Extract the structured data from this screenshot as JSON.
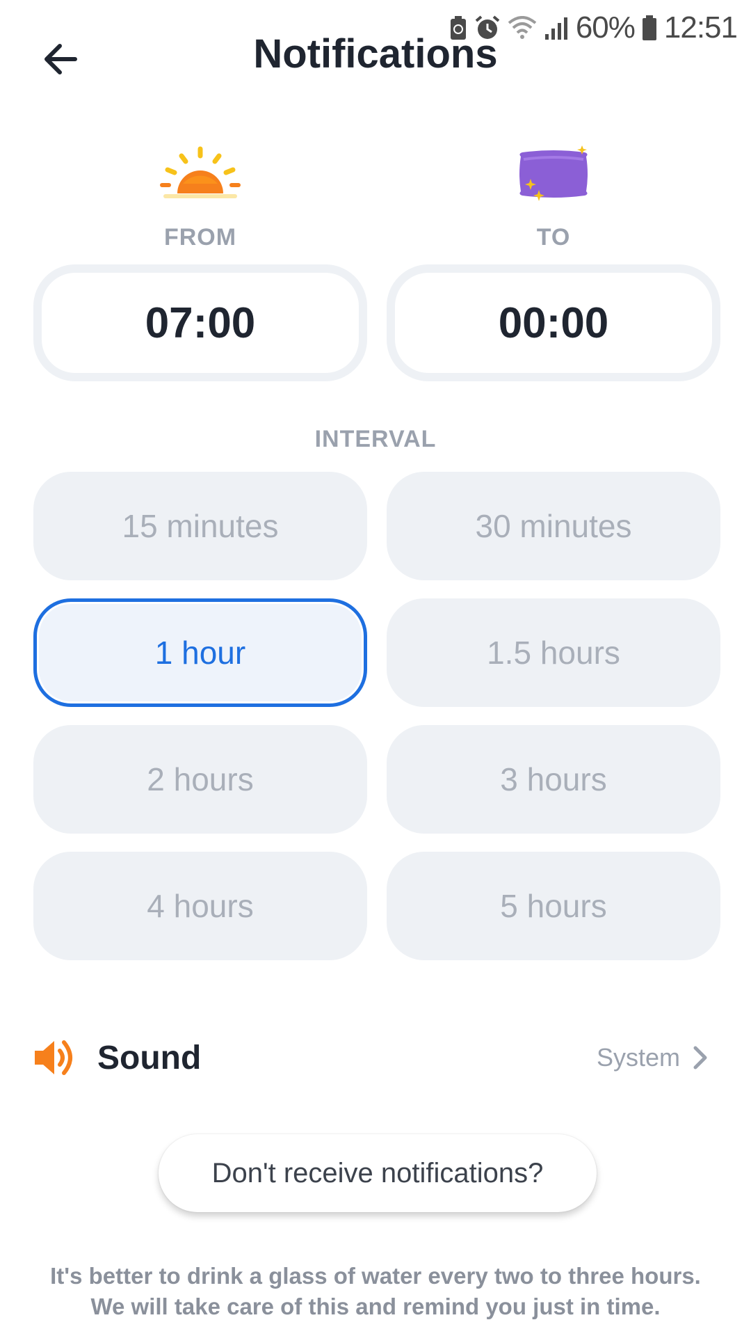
{
  "status_bar": {
    "battery_percent": "60%",
    "time": "12:51",
    "icons": [
      "battery-saver-icon",
      "alarm-icon",
      "wifi-icon",
      "signal-icon",
      "battery-icon"
    ]
  },
  "header": {
    "title": "Notifications",
    "back_icon": "back-arrow-icon"
  },
  "from": {
    "label": "FROM",
    "time": "07:00",
    "icon": "sunrise-icon"
  },
  "to": {
    "label": "TO",
    "time": "00:00",
    "icon": "moon-pillow-icon"
  },
  "interval": {
    "label": "INTERVAL",
    "selected": "1 hour",
    "options": [
      "15 minutes",
      "30 minutes",
      "1 hour",
      "1.5 hours",
      "2 hours",
      "3 hours",
      "4 hours",
      "5 hours"
    ]
  },
  "sound": {
    "label": "Sound",
    "value": "System",
    "icon": "speaker-icon"
  },
  "dont_receive_button": "Don't receive notifications?",
  "footer": {
    "line1": "It's better to drink a glass of water every two to three hours.",
    "line2": "We will take care of this and remind you just in time."
  },
  "colors": {
    "accent": "#1e6fe0",
    "option_bg": "#eef1f5",
    "muted_text": "#9aa1ad",
    "sun_orange": "#f6801c",
    "pillow_purple": "#8b5fd6",
    "moon_yellow": "#f5c21b"
  }
}
